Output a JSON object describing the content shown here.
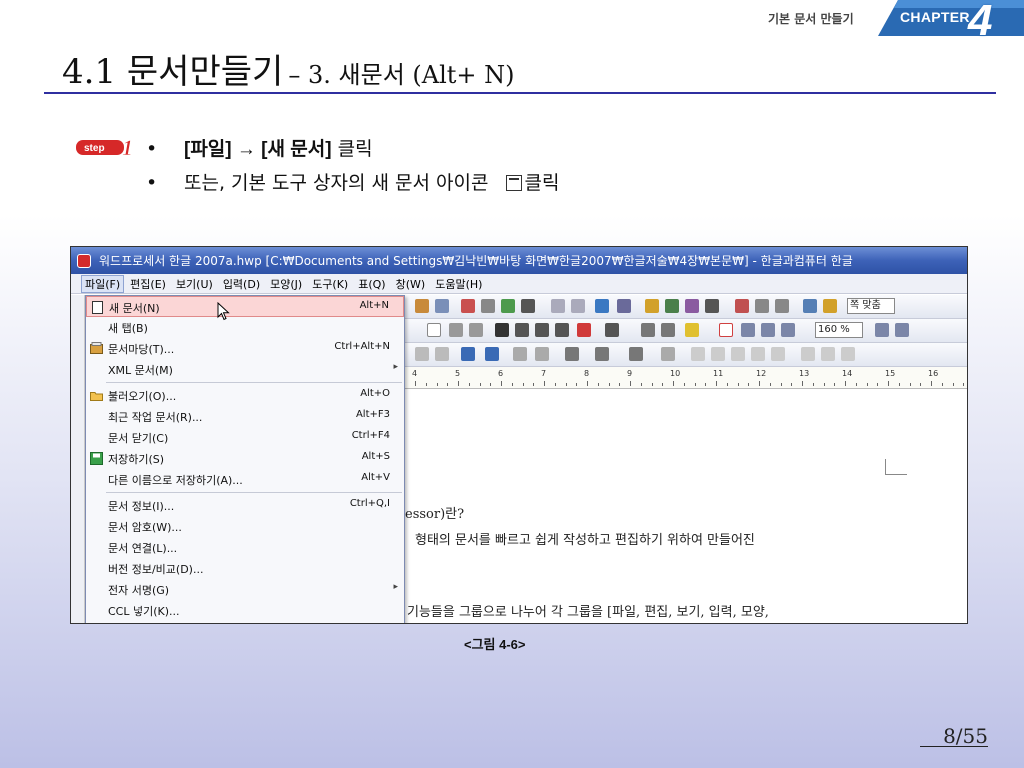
{
  "chapter": {
    "label": "기본 문서 만들기",
    "badge_text": "CHAPTER",
    "number": "4"
  },
  "title": {
    "main": "4.1 문서만들기",
    "sub": "– 3. 새문서 (Alt+ N)"
  },
  "step_badge": "step 1",
  "bullets": [
    {
      "dot": "•",
      "text_bold": "[파일] → [새 문서]",
      "text_rest": " 클릭"
    },
    {
      "dot": "•",
      "text_before": "또는, 기본 도구 상자의 새 문서 아이콘",
      "text_after": "클릭"
    }
  ],
  "screenshot": {
    "window_title": "워드프로세서 한글 2007a.hwp [C:₩Documents and Settings₩김낙빈₩바탕 화면₩한글2007₩한글저술₩4장₩본문₩] - 한글과컴퓨터 한글",
    "menubar": [
      "파일(F)",
      "편집(E)",
      "보기(U)",
      "입력(D)",
      "모양(J)",
      "도구(K)",
      "표(Q)",
      "창(W)",
      "도움말(H)"
    ],
    "zoom": "160 %",
    "view_label": "쪽 맞춤",
    "ruler_numbers": [
      "4",
      "5",
      "6",
      "7",
      "8",
      "9",
      "10",
      "11",
      "12",
      "13",
      "14",
      "15",
      "16"
    ],
    "file_menu": [
      {
        "label": "새 문서(N)",
        "shortcut": "Alt+N",
        "icon": "new-document-icon",
        "highlight": true
      },
      {
        "label": "새 탭(B)",
        "shortcut": ""
      },
      {
        "label": "문서마당(T)...",
        "shortcut": "Ctrl+Alt+N",
        "icon": "template-icon"
      },
      {
        "label": "XML 문서(M)",
        "shortcut": "",
        "submenu": true
      },
      {
        "label": "불러오기(O)...",
        "shortcut": "Alt+O",
        "icon": "open-folder-icon"
      },
      {
        "label": "최근 작업 문서(R)...",
        "shortcut": "Alt+F3"
      },
      {
        "label": "문서 닫기(C)",
        "shortcut": "Ctrl+F4"
      },
      {
        "label": "저장하기(S)",
        "shortcut": "Alt+S",
        "icon": "save-icon"
      },
      {
        "label": "다른 이름으로 저장하기(A)...",
        "shortcut": "Alt+V"
      },
      {
        "label": "문서 정보(I)...",
        "shortcut": "Ctrl+Q,I"
      },
      {
        "label": "문서 암호(W)...",
        "shortcut": ""
      },
      {
        "label": "문서 연결(L)...",
        "shortcut": ""
      },
      {
        "label": "버전 정보/비교(D)...",
        "shortcut": ""
      },
      {
        "label": "전자 서명(G)",
        "shortcut": "",
        "submenu": true
      },
      {
        "label": "CCL 넣기(K)...",
        "shortcut": ""
      }
    ],
    "doc_lines": [
      "essor)란?",
      "형태의 문서를 빠르고 쉽게 작성하고 편집하기 위하여 만들어진",
      "기능들을 그룹으로 나누어 각 그룹을 [파일, 편집, 보기, 입력, 모양,"
    ]
  },
  "caption": "<그림 4-6>",
  "page_number": "8/55",
  "colors": {
    "title_rule": "#2f2fa0",
    "chapter_badge": "#2a6ab3",
    "step_badge": "#d62828",
    "menu_highlight": "#fbd6d6"
  }
}
